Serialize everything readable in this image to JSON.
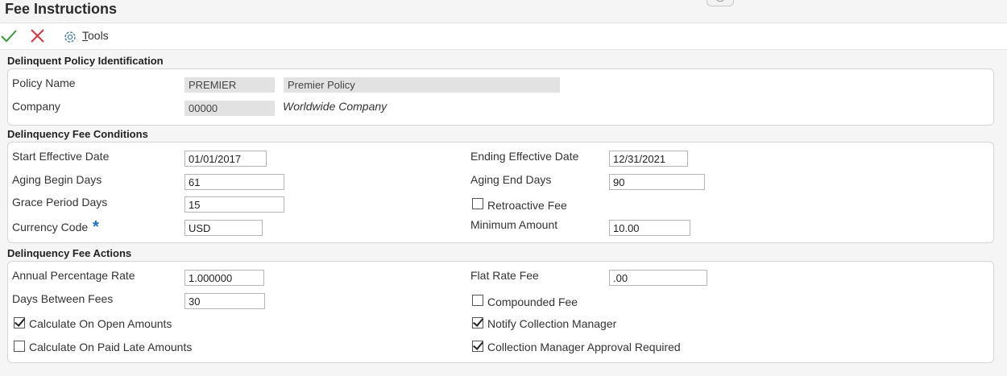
{
  "header": {
    "title": "Fee Instructions"
  },
  "toolbar": {
    "tools_prefix": "",
    "tools_hotkey": "T",
    "tools_rest": "ools",
    "ok_icon": "checkmark-icon",
    "cancel_icon": "x-icon",
    "tools_icon": "gear-icon",
    "ok_color": "#3a9a3a",
    "cancel_color": "#d9363e"
  },
  "policy_identification": {
    "title": "Delinquent Policy Identification",
    "policy_name_label": "Policy Name",
    "policy_name_code": "PREMIER",
    "policy_name_description": "Premier Policy",
    "company_label": "Company",
    "company_code": "00000",
    "company_name": "Worldwide Company"
  },
  "fee_conditions": {
    "title": "Delinquency Fee Conditions",
    "start_effective_date_label": "Start Effective Date",
    "start_effective_date": "01/01/2017",
    "ending_effective_date_label": "Ending Effective Date",
    "ending_effective_date": "12/31/2021",
    "aging_begin_days_label": "Aging Begin Days",
    "aging_begin_days": "61",
    "aging_end_days_label": "Aging End Days",
    "aging_end_days": "90",
    "grace_period_days_label": "Grace Period Days",
    "grace_period_days": "15",
    "retroactive_fee_label": "Retroactive Fee",
    "retroactive_fee_checked": false,
    "currency_code_label": "Currency Code",
    "currency_code_required_marker": "*",
    "currency_code": "USD",
    "minimum_amount_label": "Minimum Amount",
    "minimum_amount": "10.00"
  },
  "fee_actions": {
    "title": "Delinquency Fee Actions",
    "annual_percentage_rate_label": "Annual Percentage Rate",
    "annual_percentage_rate": "1.000000",
    "flat_rate_fee_label": "Flat Rate Fee",
    "flat_rate_fee": ".00",
    "days_between_fees_label": "Days Between Fees",
    "days_between_fees": "30",
    "compounded_fee_label": "Compounded Fee",
    "compounded_fee_checked": false,
    "calculate_on_open_amounts_label": "Calculate On Open Amounts",
    "calculate_on_open_amounts_checked": true,
    "notify_collection_manager_label": "Notify Collection Manager",
    "notify_collection_manager_checked": true,
    "calculate_on_paid_late_amounts_label": "Calculate On Paid Late Amounts",
    "calculate_on_paid_late_amounts_checked": false,
    "collection_manager_approval_required_label": "Collection Manager Approval Required",
    "collection_manager_approval_required_checked": true
  }
}
